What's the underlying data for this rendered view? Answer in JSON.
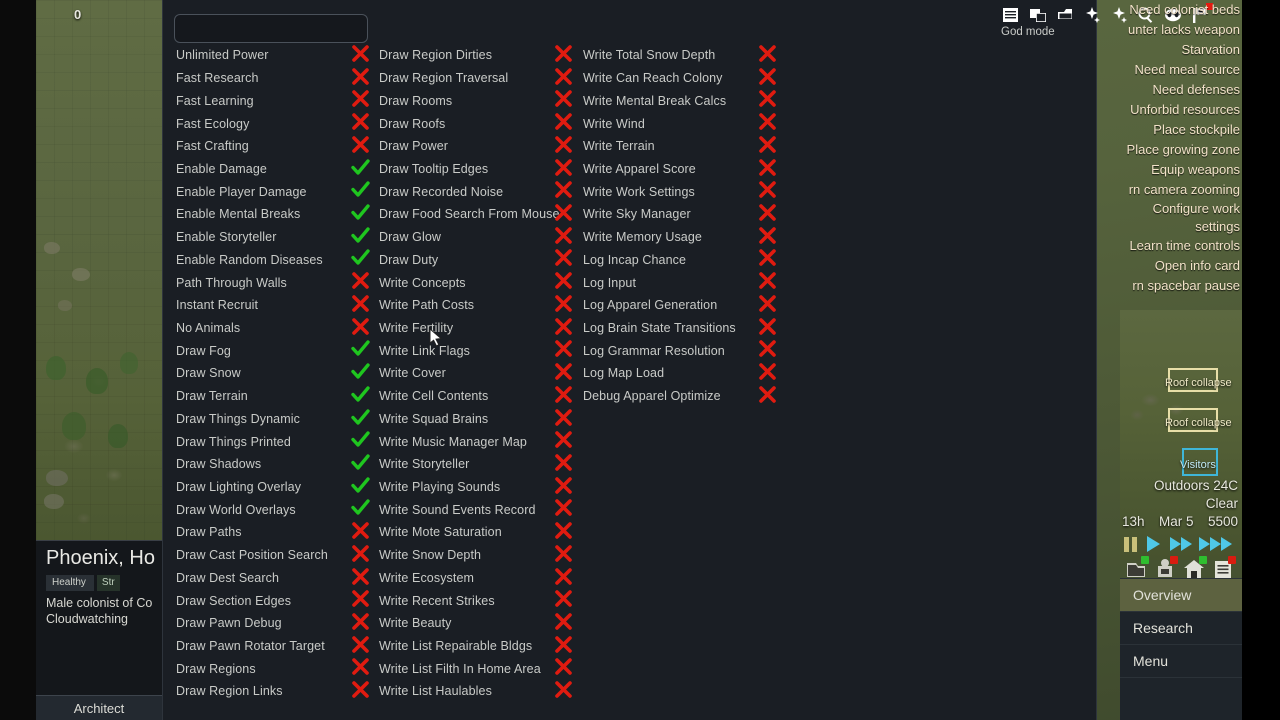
{
  "map": {
    "counter": "0"
  },
  "pawn": {
    "name": "Phoenix, Ho",
    "health_badge": "Healthy",
    "mood_badge": "Str",
    "description": "Male colonist of Co",
    "activity": "Cloudwatching",
    "architect_label": "Architect"
  },
  "debug_window": {
    "search_placeholder": "",
    "search_value": "",
    "close_label": "×",
    "god_mode_label": "God mode",
    "toolbar_icons": [
      "log-list-icon",
      "duplicate-icon",
      "package-icon",
      "sparkle-icon",
      "sparkle-alt-icon",
      "search-icon",
      "alien-face-icon",
      "flag-icon"
    ],
    "columns": [
      {
        "items": [
          {
            "label": "Unlimited Power",
            "enabled": false
          },
          {
            "label": "Fast Research",
            "enabled": false
          },
          {
            "label": "Fast Learning",
            "enabled": false
          },
          {
            "label": "Fast Ecology",
            "enabled": false
          },
          {
            "label": "Fast Crafting",
            "enabled": false
          },
          {
            "label": "Enable Damage",
            "enabled": true
          },
          {
            "label": "Enable Player Damage",
            "enabled": true
          },
          {
            "label": "Enable Mental Breaks",
            "enabled": true
          },
          {
            "label": "Enable Storyteller",
            "enabled": true
          },
          {
            "label": "Enable Random Diseases",
            "enabled": true
          },
          {
            "label": "Path Through Walls",
            "enabled": false
          },
          {
            "label": "Instant Recruit",
            "enabled": false
          },
          {
            "label": "No Animals",
            "enabled": false
          },
          {
            "label": "Draw Fog",
            "enabled": true
          },
          {
            "label": "Draw Snow",
            "enabled": true
          },
          {
            "label": "Draw Terrain",
            "enabled": true
          },
          {
            "label": "Draw Things Dynamic",
            "enabled": true
          },
          {
            "label": "Draw Things Printed",
            "enabled": true
          },
          {
            "label": "Draw Shadows",
            "enabled": true
          },
          {
            "label": "Draw Lighting Overlay",
            "enabled": true
          },
          {
            "label": "Draw World Overlays",
            "enabled": true
          },
          {
            "label": "Draw Paths",
            "enabled": false
          },
          {
            "label": "Draw Cast Position Search",
            "enabled": false
          },
          {
            "label": "Draw Dest Search",
            "enabled": false
          },
          {
            "label": "Draw Section Edges",
            "enabled": false
          },
          {
            "label": "Draw Pawn Debug",
            "enabled": false
          },
          {
            "label": "Draw Pawn Rotator Target",
            "enabled": false
          },
          {
            "label": "Draw Regions",
            "enabled": false
          },
          {
            "label": "Draw Region Links",
            "enabled": false
          }
        ]
      },
      {
        "items": [
          {
            "label": "Draw Region Dirties",
            "enabled": false
          },
          {
            "label": "Draw Region Traversal",
            "enabled": false
          },
          {
            "label": "Draw Rooms",
            "enabled": false
          },
          {
            "label": "Draw Roofs",
            "enabled": false
          },
          {
            "label": "Draw Power",
            "enabled": false
          },
          {
            "label": "Draw Tooltip Edges",
            "enabled": false
          },
          {
            "label": "Draw Recorded Noise",
            "enabled": false
          },
          {
            "label": "Draw Food Search From Mouse",
            "enabled": false
          },
          {
            "label": "Draw Glow",
            "enabled": false
          },
          {
            "label": "Draw Duty",
            "enabled": false
          },
          {
            "label": "Write Concepts",
            "enabled": false
          },
          {
            "label": "Write Path Costs",
            "enabled": false
          },
          {
            "label": "Write Fertility",
            "enabled": false
          },
          {
            "label": "Write Link Flags",
            "enabled": false
          },
          {
            "label": "Write Cover",
            "enabled": false
          },
          {
            "label": "Write Cell Contents",
            "enabled": false
          },
          {
            "label": "Write Squad Brains",
            "enabled": false
          },
          {
            "label": "Write Music Manager Map",
            "enabled": false
          },
          {
            "label": "Write Storyteller",
            "enabled": false
          },
          {
            "label": "Write Playing Sounds",
            "enabled": false
          },
          {
            "label": "Write Sound Events Record",
            "enabled": false
          },
          {
            "label": "Write Mote Saturation",
            "enabled": false
          },
          {
            "label": "Write Snow Depth",
            "enabled": false
          },
          {
            "label": "Write Ecosystem",
            "enabled": false
          },
          {
            "label": "Write Recent Strikes",
            "enabled": false
          },
          {
            "label": "Write Beauty",
            "enabled": false
          },
          {
            "label": "Write List Repairable Bldgs",
            "enabled": false
          },
          {
            "label": "Write List Filth In Home Area",
            "enabled": false
          },
          {
            "label": "Write List Haulables",
            "enabled": false
          }
        ]
      },
      {
        "items": [
          {
            "label": "Write Total Snow Depth",
            "enabled": false
          },
          {
            "label": "Write Can Reach Colony",
            "enabled": false
          },
          {
            "label": "Write Mental Break Calcs",
            "enabled": false
          },
          {
            "label": "Write Wind",
            "enabled": false
          },
          {
            "label": "Write Terrain",
            "enabled": false
          },
          {
            "label": "Write Apparel Score",
            "enabled": false
          },
          {
            "label": "Write Work Settings",
            "enabled": false
          },
          {
            "label": "Write Sky Manager",
            "enabled": false
          },
          {
            "label": "Write Memory Usage",
            "enabled": false
          },
          {
            "label": "Log Incap Chance",
            "enabled": false
          },
          {
            "label": "Log Input",
            "enabled": false
          },
          {
            "label": "Log Apparel Generation",
            "enabled": false
          },
          {
            "label": "Log Brain State Transitions",
            "enabled": false
          },
          {
            "label": "Log Grammar Resolution",
            "enabled": false
          },
          {
            "label": "Log Map Load",
            "enabled": false
          },
          {
            "label": "Debug Apparel Optimize",
            "enabled": false
          }
        ]
      }
    ]
  },
  "alerts": {
    "items": [
      {
        "text": "Need colonist beds",
        "two_line": false
      },
      {
        "text": "unter lacks weapon",
        "two_line": false
      },
      {
        "text": "Starvation",
        "two_line": false
      },
      {
        "text": "Need meal source",
        "two_line": false
      },
      {
        "text": "Need defenses",
        "two_line": false
      },
      {
        "text": "Unforbid resources",
        "two_line": false
      },
      {
        "text": "Place stockpile",
        "two_line": false
      },
      {
        "text": "Place growing zone",
        "two_line": false
      },
      {
        "text": "Equip weapons",
        "two_line": false
      },
      {
        "text": "rn camera zooming",
        "two_line": false
      },
      {
        "text": "Configure work settings",
        "two_line": true
      },
      {
        "text": "Learn time controls",
        "two_line": false
      },
      {
        "text": "Open info card",
        "two_line": false
      },
      {
        "text": "rn spacebar pause",
        "two_line": false
      }
    ]
  },
  "game_panel": {
    "zone_labels": [
      {
        "text": "Roof collapse",
        "color": "cyan_no"
      },
      {
        "text": "Roof collapse",
        "color": "cyan_no"
      },
      {
        "text": "Visitors",
        "color": "cyan"
      }
    ],
    "outdoors_temp": "Outdoors 24C",
    "weather": "Clear",
    "time": "13h",
    "date": "Mar 5",
    "year": "5500",
    "speed_controls": [
      "pause-button",
      "play-button",
      "fast-forward-button",
      "ultra-fast-button"
    ],
    "bottom_icons": [
      "work-tab-icon",
      "research-tab-icon",
      "architect-home-icon",
      "quests-tab-icon"
    ],
    "tabs": [
      {
        "label": "Overview",
        "active": true
      },
      {
        "label": "Research",
        "active": false
      },
      {
        "label": "Menu",
        "active": false
      }
    ]
  },
  "colors": {
    "check_green": "#1fc61f",
    "cross_red": "#e01b10",
    "panel_bg": "#1a1e24",
    "alert_text": "#f2e2c8",
    "tab_active": "#5d6240"
  }
}
